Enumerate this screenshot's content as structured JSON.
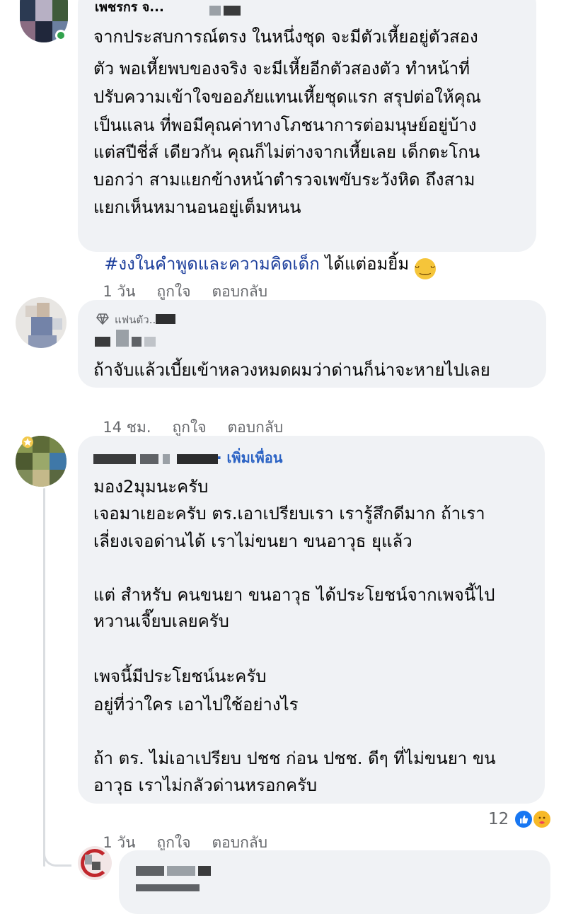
{
  "comments": [
    {
      "name": "เพชรกร จ...",
      "lines": [
        "จากประสบการณ์ตรง ในหนึ่งชุด จะมีตัวเหี้ยอยู่ตัวสอง",
        "ตัว พอเหี้ยพบของจริง จะมีเหี้ยอีกตัวสองตัว ทำหน้าที่",
        "ปรับความเข้าใจขออภัยแทนเหี้ยชุดแรก สรุปต่อให้คุณ",
        "เป็นแลน ที่พอมีคุณค่าทางโภชนาการต่อมนุษย์อยู่บ้าง",
        "แต่สปีชี่ส์ เดียวกัน คุณก็ไม่ต่างจากเหี้ยเลย เด็กตะโกน",
        "บอกว่า สามแยกข้างหน้าตำรวจเพขับระวังหิด ถึงสาม",
        "แยกเห็นหมานอนอยู่เต็มหนน"
      ],
      "hashtag": "#งงในคำพูดและความคิดเด็ก",
      "tail": " ได้แต่อมยิ้ม",
      "emoji": "grinning-face-emoji",
      "time": "1 วัน",
      "like": "ถูกใจ",
      "reply": "ตอบกลับ"
    },
    {
      "badge": "แฟนตัว...",
      "lines": [
        "ถ้าจับแล้วเบี้ยเข้าหลวงหมดผมว่าด่านก็น่าจะหายไปเลย"
      ],
      "time": "14 ชม.",
      "like": "ถูกใจ",
      "reply": "ตอบกลับ"
    },
    {
      "add_friend": "· เพิ่มเพื่อน",
      "lines": [
        "มอง2มุมนะครับ",
        "เจอมาเยอะครับ ตร.เอาเปรียบเรา เรารู้สึกดีมาก ถ้าเรา",
        "เลี่ยงเจอด่านได้ เราไม่ขนยา ขนอาวุธ ยุแล้ว",
        "",
        "แต่ สำหรับ คนขนยา ขนอาวุธ ได้ประโยชน์จากเพจนี้ไป",
        "หวานเจี๊ยบเลยครับ",
        "",
        "เพจนี้มีประโยชน์นะครับ",
        "อยู่ที่ว่าใคร เอาไปใช้อย่างไร",
        "",
        "ถ้า ตร. ไม่เอาเปรียบ ปชช ก่อน ปชช. ดีๆ ที่ไม่ขนยา ขน",
        "อาวุธ เราไม่กลัวด่านหรอกครับ"
      ],
      "time": "1 วัน",
      "like": "ถูกใจ",
      "reply": "ตอบกลับ",
      "reaction_count": "12",
      "reaction_icons": [
        "like-reaction-icon",
        "care-reaction-icon"
      ]
    }
  ],
  "colors": {
    "bubble": "#f0f2f5",
    "meta": "#65676b",
    "link": "#2c63c4",
    "online": "#31a24c"
  }
}
